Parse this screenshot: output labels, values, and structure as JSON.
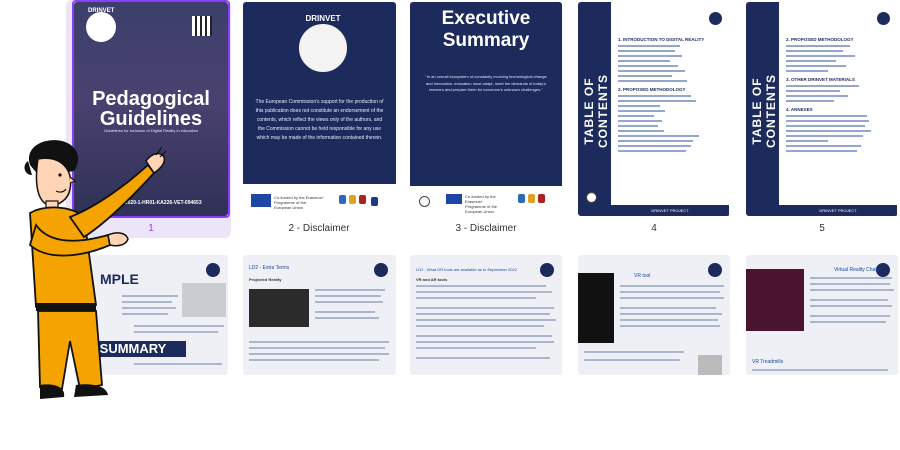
{
  "pages": [
    {
      "number": "1",
      "logo": "DRINVET",
      "title_line1": "Pedagogical",
      "title_line2": "Guidelines",
      "subtitle": "Guidelines for inclusion of Digital Reality in education",
      "project": "project n° 2020-1-HR01-KA226-VET-094653"
    },
    {
      "label": "2 - Disclaimer",
      "logo": "DRINVET",
      "body": "The European Commission's support for the production of this publication does not constitute an endorsement of the contents, which reflect the views only of the authors, and the Commission cannot be held responsible for any use which may be made of the information contained therein.",
      "eu_text": "Co-funded by the Erasmus+ Programme of the European Union"
    },
    {
      "label": "3 - Disclaimer",
      "title_line1": "Executive",
      "title_line2": "Summary",
      "body": "\"In an overall ecosystem of constantly evolving technological change and innovation, education must adapt, meet the demands of today's learners and prepare them for tomorrow's unknown challenges.\"",
      "eu_text": "Co-funded by the Erasmus+ Programme of the European Union"
    },
    {
      "label": "4",
      "sidebar_title": "TABLE OF CONTENTS",
      "sections": [
        "1. INTRODUCTION TO DIGITAL REALITY",
        "2. PROPOSED METHODOLOGY"
      ],
      "footer": "DRINVET PROJECT"
    },
    {
      "label": "5",
      "sidebar_title": "TABLE OF CONTENTS",
      "sections": [
        "2. PROPOSED METHODOLOGY",
        "3. OTHER DRINVET MATERIALS",
        "4. ANNEXES"
      ],
      "footer": "DRINVET PROJECT"
    }
  ],
  "bottom_pages": [
    {
      "heading": "",
      "big1": "MPLE",
      "big2": "SUMMARY"
    },
    {
      "heading": "LD2 - Extra Terms",
      "subheading": "Projected Reality"
    },
    {
      "heading": "LD2 - What DR tools are available as to September 2022",
      "subheading": "VR and AR tools"
    },
    {
      "heading": "VR tool"
    },
    {
      "heading": "Virtual Reality Chairs",
      "subheading": "VR Treadmills"
    }
  ],
  "colors": {
    "navy": "#1c2a5c",
    "selection": "#8b3dff",
    "character_suit": "#f5a300"
  }
}
